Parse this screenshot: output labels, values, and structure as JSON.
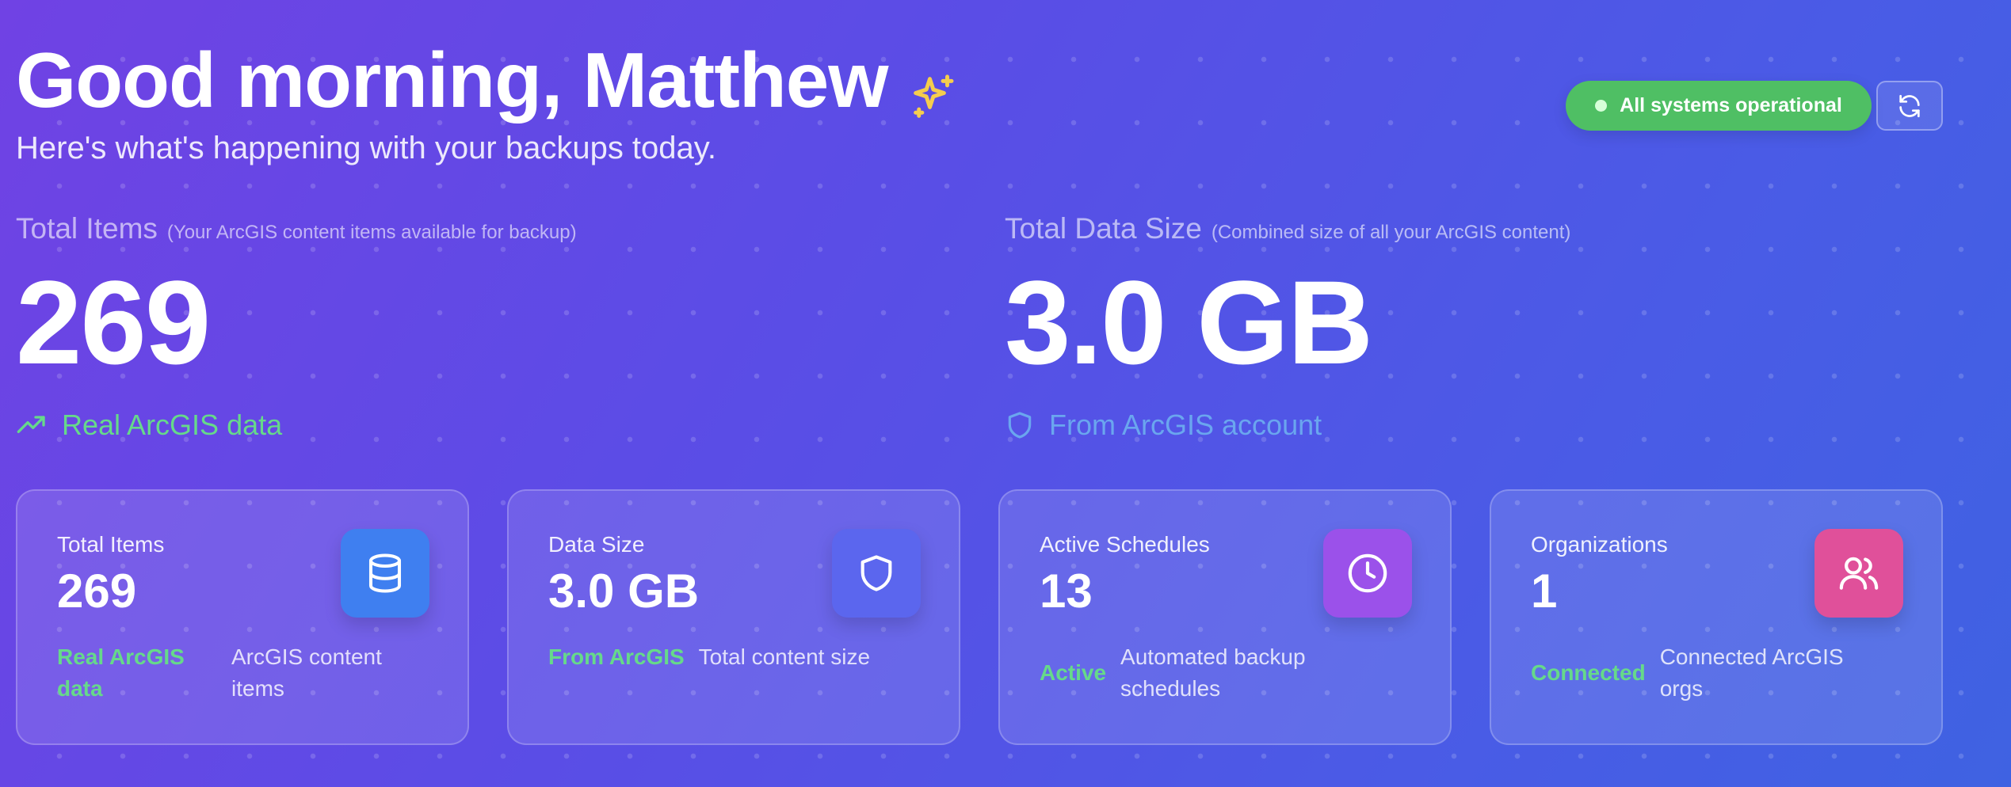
{
  "header": {
    "greeting": "Good morning, Matthew",
    "subtitle": "Here's what's happening with your backups today.",
    "status_label": "All systems operational",
    "sparkle_icon": "sparkle-icon",
    "refresh_icon": "refresh-icon"
  },
  "summary": {
    "items": {
      "label": "Total Items",
      "hint": "(Your ArcGIS content items available for backup)",
      "value": "269",
      "note": "Real ArcGIS data",
      "icon": "trending-up-icon"
    },
    "size": {
      "label": "Total Data Size",
      "hint": "(Combined size of all your ArcGIS content)",
      "value": "3.0 GB",
      "note": "From ArcGIS account",
      "icon": "shield-icon"
    }
  },
  "cards": [
    {
      "title": "Total Items",
      "value": "269",
      "status": "Real ArcGIS data",
      "description": "ArcGIS content items",
      "icon": "database-icon",
      "color": "#3f7ff0"
    },
    {
      "title": "Data Size",
      "value": "3.0 GB",
      "status": "From ArcGIS",
      "description": "Total content size",
      "icon": "shield-icon",
      "color": "#5b66ee"
    },
    {
      "title": "Active Schedules",
      "value": "13",
      "status": "Active",
      "description": "Automated backup schedules",
      "icon": "clock-icon",
      "color": "#9b51ea"
    },
    {
      "title": "Organizations",
      "value": "1",
      "status": "Connected",
      "description": "Connected ArcGIS orgs",
      "icon": "users-icon",
      "color": "#e0509a"
    }
  ],
  "colors": {
    "status_green": "#4fbf64",
    "accent_green_text": "#66d98a",
    "accent_blue_text": "#6aa6ef",
    "sparkle": "#f5cd4d"
  }
}
